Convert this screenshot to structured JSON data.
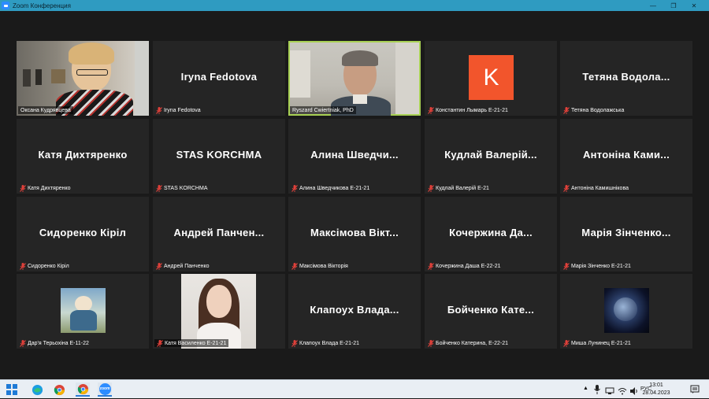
{
  "window": {
    "title": "Zoom Конференция",
    "controls": [
      "—",
      "❐",
      "✕"
    ]
  },
  "participants": [
    {
      "id": "p1",
      "display": "",
      "caption": "Оксана Кудрявцева",
      "muted": false,
      "video": "woman-glasses"
    },
    {
      "id": "p2",
      "display": "Iryna Fedotova",
      "caption": "Iryna Fedotova",
      "muted": true
    },
    {
      "id": "p3",
      "display": "",
      "caption": "Ryszard Cwiertniak, PhD",
      "muted": false,
      "video": "man",
      "active": true
    },
    {
      "id": "p4",
      "display": "K",
      "caption": "Константин Лымарь Е-21-21",
      "muted": true,
      "avatar": true
    },
    {
      "id": "p5",
      "display": "Тетяна Водола...",
      "caption": "Тетяна Водолажська",
      "muted": true
    },
    {
      "id": "p6",
      "display": "Катя Дихтяренко",
      "caption": "Катя Дихтяренко",
      "muted": true
    },
    {
      "id": "p7",
      "display": "STAS KORCHMA",
      "caption": "STAS KORCHMA",
      "muted": true
    },
    {
      "id": "p8",
      "display": "Алина Шведчи...",
      "caption": "Алина Шведчикова Е-21-21",
      "muted": true
    },
    {
      "id": "p9",
      "display": "Кудлай Валерій...",
      "caption": "Кудлай Валерій Е-21",
      "muted": true
    },
    {
      "id": "p10",
      "display": "Антоніна Ками...",
      "caption": "Антоніна Камишнікова",
      "muted": true
    },
    {
      "id": "p11",
      "display": "Сидоренко Кіріл",
      "caption": "Сидоренко Кіріл",
      "muted": true
    },
    {
      "id": "p12",
      "display": "Андрей Панчен...",
      "caption": "Андрей Панченко",
      "muted": true
    },
    {
      "id": "p13",
      "display": "Максімова Вікт...",
      "caption": "Максімова Вікторія",
      "muted": true
    },
    {
      "id": "p14",
      "display": "Кочержина Да...",
      "caption": "Кочержина Даша Е-22-21",
      "muted": true
    },
    {
      "id": "p15",
      "display": "Марія Зінченко...",
      "caption": "Марія Зінченко Е-21-21",
      "muted": true
    },
    {
      "id": "p16",
      "display": "",
      "caption": "Дар'я Терьохіна Е-11-22",
      "muted": true,
      "photo": "child"
    },
    {
      "id": "p17",
      "display": "",
      "caption": "Катя Василенко Е-21-21",
      "muted": true,
      "photo": "girl"
    },
    {
      "id": "p18",
      "display": "Клапоух Влада...",
      "caption": "Клапоух Влада Е-21-21",
      "muted": true
    },
    {
      "id": "p19",
      "display": "Бойченко Кате...",
      "caption": "Бойченко Катерина, Е-22-21",
      "muted": true
    },
    {
      "id": "p20",
      "display": "",
      "caption": "Миша Лунинец Е-21-21",
      "muted": true,
      "photo": "space"
    }
  ],
  "taskbar": {
    "apps": [
      "windows-start",
      "edge-browser",
      "chrome-browser",
      "chrome-profile",
      "zoom-app"
    ],
    "zoom_label": "zoom",
    "tray": {
      "language": "РУС",
      "time": "13:01",
      "date": "28.04.2023"
    }
  },
  "colors": {
    "accent_active": "#a8d154",
    "avatar_k": "#f2552c",
    "muted_icon": "#e0403a",
    "titlebar": "#2f9bc1"
  }
}
